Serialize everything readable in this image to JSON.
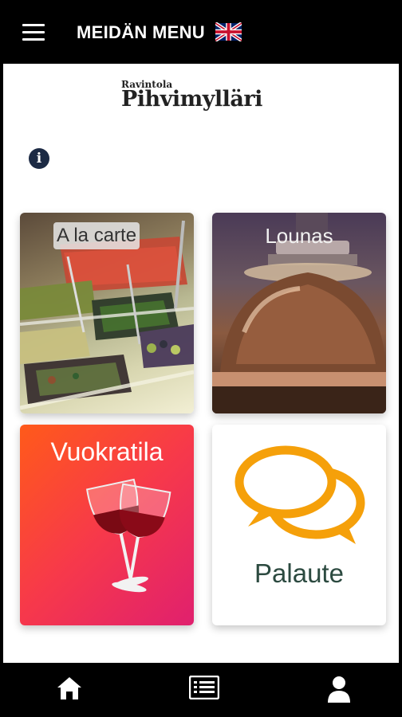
{
  "header": {
    "title": "MEIDÄN MENU",
    "menu_icon": "hamburger-menu-icon",
    "language_icon": "uk-flag-icon"
  },
  "logo": {
    "small": "Ravintola",
    "big": "Pihvimylläri"
  },
  "info_icon": "info-icon",
  "tiles": [
    {
      "label": "A la carte",
      "icon": "salad-bar-image"
    },
    {
      "label": "Lounas",
      "icon": "cloche-image"
    },
    {
      "label": "Vuokratila",
      "icon": "wine-glasses-icon"
    },
    {
      "label": "Palaute",
      "icon": "speech-bubbles-icon"
    }
  ],
  "colors": {
    "bar": "#000000",
    "vuokratila_gradient_start": "#ff5a1a",
    "vuokratila_gradient_end": "#e0206e",
    "palaute_icon": "#f5a00a",
    "palaute_text": "#2c4a40"
  },
  "bottom_nav": [
    {
      "icon": "home-icon"
    },
    {
      "icon": "menu-list-icon"
    },
    {
      "icon": "user-icon"
    }
  ]
}
